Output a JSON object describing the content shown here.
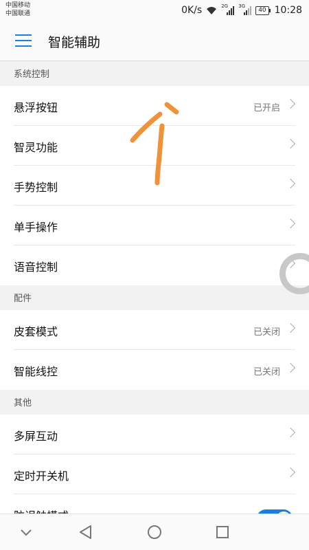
{
  "status_bar": {
    "carrier_1": "中国移动",
    "carrier_2": "中国联通",
    "speed": "0K/s",
    "network_1": "2G",
    "network_2": "3G",
    "battery": "40",
    "time": "10:28",
    "icons": [
      "wifi-icon",
      "signal-icon",
      "signal-icon",
      "battery-icon"
    ]
  },
  "header": {
    "title": "智能辅助",
    "menu_icon": "menu-icon",
    "accent_color": "#1a7de0"
  },
  "sections": [
    {
      "title": "系统控制",
      "items": [
        {
          "label": "悬浮按钮",
          "value": "已开启"
        },
        {
          "label": "智灵功能",
          "value": ""
        },
        {
          "label": "手势控制",
          "value": ""
        },
        {
          "label": "单手操作",
          "value": ""
        },
        {
          "label": "语音控制",
          "value": ""
        }
      ]
    },
    {
      "title": "配件",
      "items": [
        {
          "label": "皮套模式",
          "value": "已关闭"
        },
        {
          "label": "智能线控",
          "value": "已关闭"
        }
      ]
    },
    {
      "title": "其他",
      "items": [
        {
          "label": "多屏互动",
          "value": ""
        },
        {
          "label": "定时开关机",
          "value": ""
        },
        {
          "label": "防误触模式",
          "value": "",
          "toggle_on": true
        }
      ]
    }
  ],
  "nav_bar": {
    "icons": [
      "collapse-icon",
      "back-icon",
      "home-icon",
      "recents-icon"
    ]
  },
  "annotation": {
    "color": "#f0923a",
    "shape": "hand-drawn upward arrow"
  }
}
